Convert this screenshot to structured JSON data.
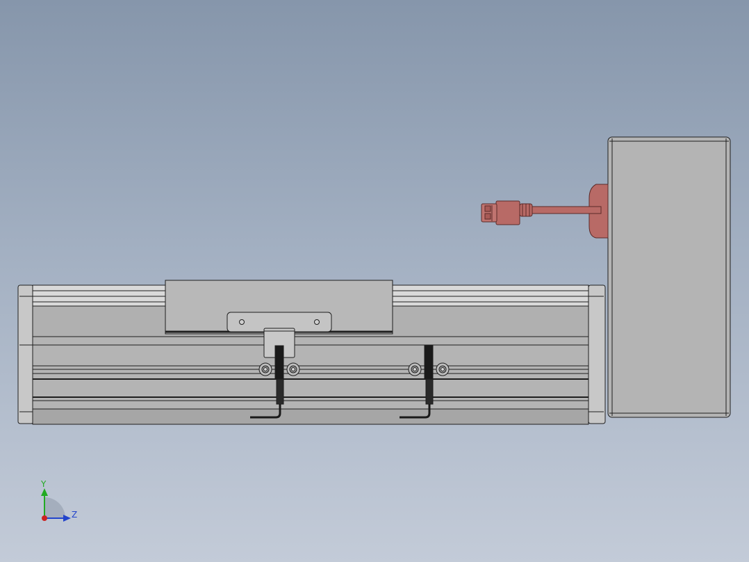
{
  "view": {
    "background_top": "#8696ab",
    "background_bottom": "#c3cbd8"
  },
  "model": {
    "part_fill": "#b4b4b4",
    "part_light": "#d2d2d2",
    "part_dark": "#9a9a9a",
    "edge_color": "#1e1e1e",
    "connector_color": "#b86a66",
    "cable_color": "#1a1a1a"
  },
  "triad": {
    "y_label": "Y",
    "z_label": "Z",
    "y_color": "#22aa22",
    "z_color": "#2244cc",
    "x_color": "#cc2222"
  }
}
